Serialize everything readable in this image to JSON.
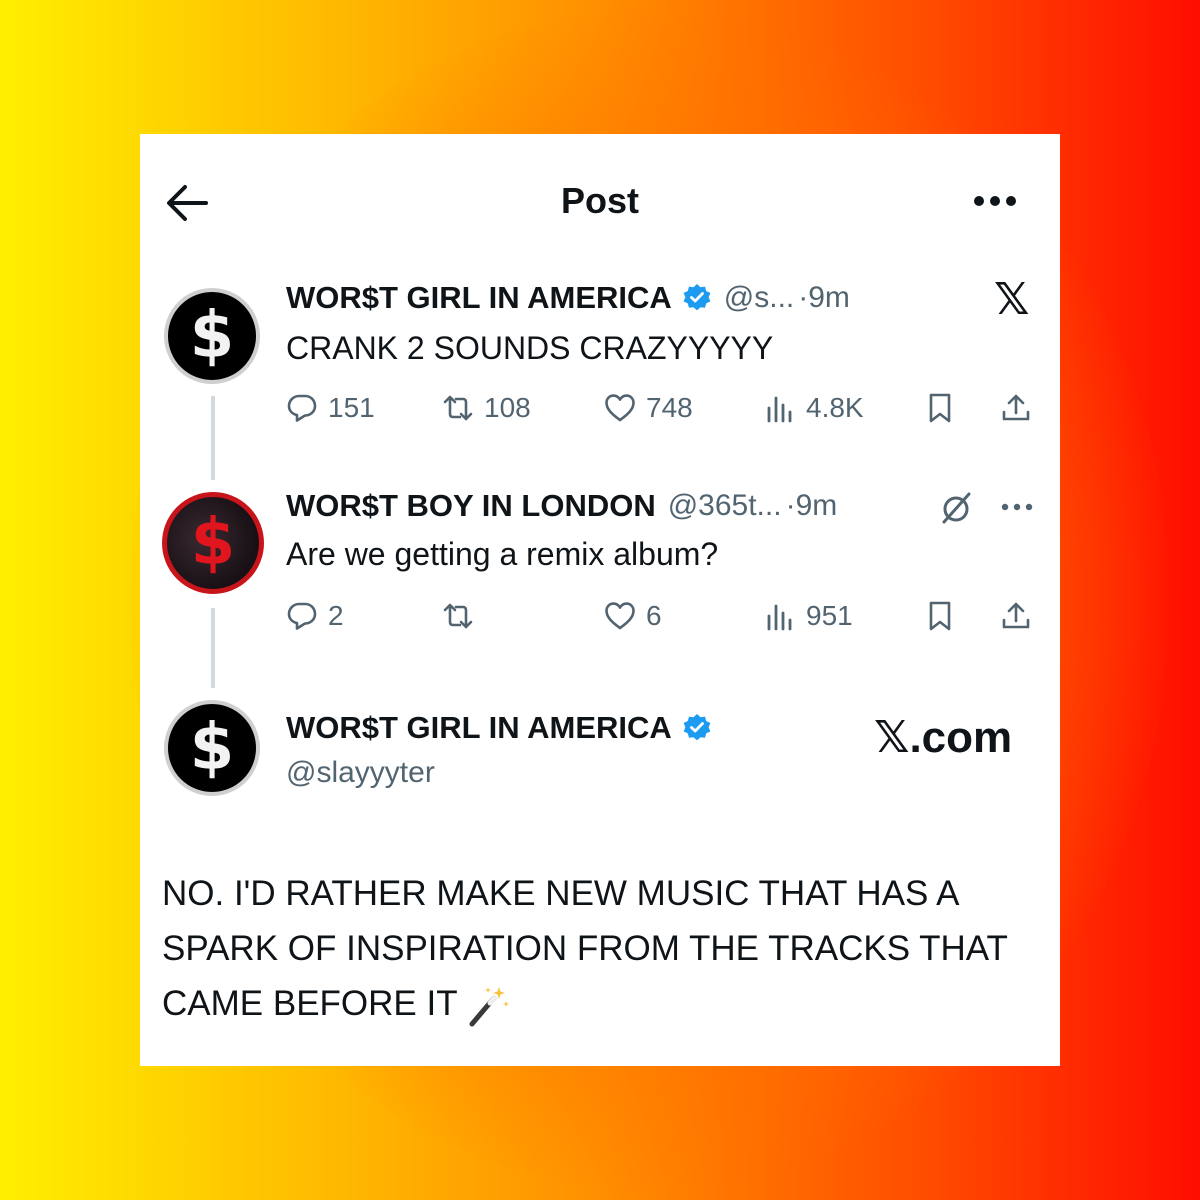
{
  "header": {
    "title": "Post"
  },
  "tweet1": {
    "name": "WOR$T GIRL IN AMERICA",
    "handle": "@s...",
    "time": "·9m",
    "text": "CRANK 2 SOUNDS CRAZYYYYY",
    "replies": "151",
    "reposts": "108",
    "likes": "748",
    "views": "4.8K",
    "avatar_glyph": "$",
    "x_mark": "𝕏"
  },
  "tweet2": {
    "name": "WOR$T BOY IN LONDON",
    "handle": "@365t...",
    "time": "·9m",
    "text": "Are we getting a remix album?",
    "replies": "2",
    "likes": "6",
    "views": "951",
    "avatar_glyph": "$"
  },
  "tweet3": {
    "name": "WOR$T GIRL IN AMERICA",
    "handle": "@slayyyter",
    "brand": "𝕏.com",
    "avatar_glyph": "$",
    "text": "NO. I'D RATHER MAKE NEW MUSIC THAT HAS A SPARK OF INSPIRATION FROM THE TRACKS THAT CAME BEFORE IT"
  },
  "colors": {
    "verified": "#1d9bf0",
    "muted": "#536471",
    "text": "#0f1419",
    "avatar_ring_red": "#c8151b"
  },
  "icons": [
    "back-arrow-icon",
    "more-icon",
    "verified-icon",
    "reply-icon",
    "repost-icon",
    "like-icon",
    "views-icon",
    "bookmark-icon",
    "share-icon",
    "grok-icon",
    "magic-wand-icon"
  ]
}
